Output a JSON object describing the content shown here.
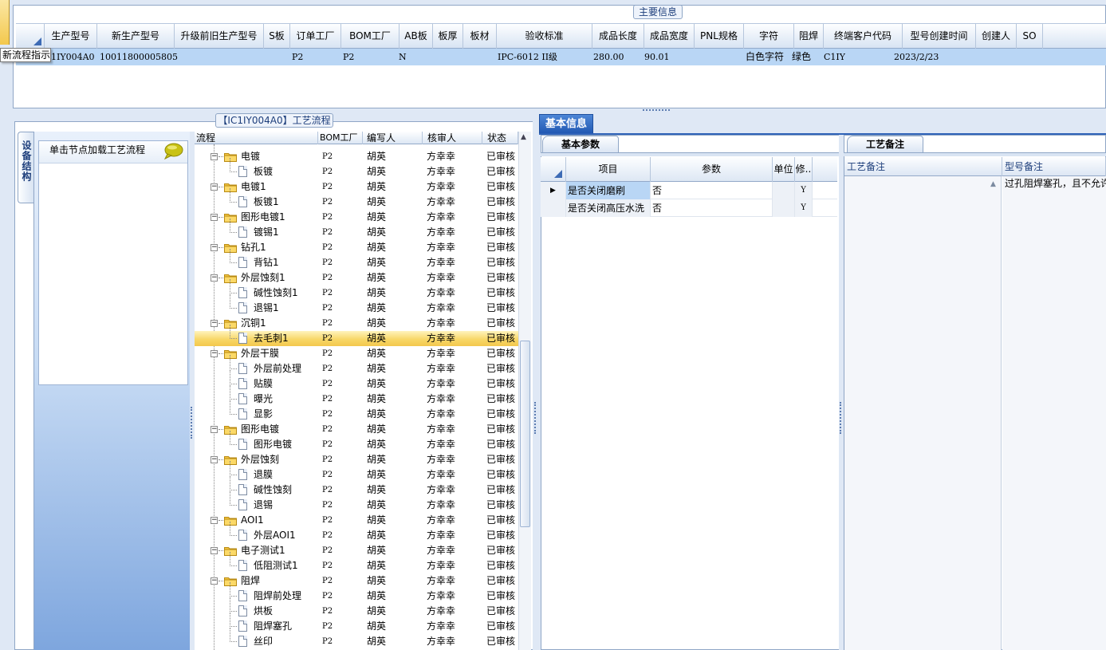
{
  "main_info": {
    "legend": "主要信息",
    "tooltip": "新流程指示",
    "columns": [
      "生产型号",
      "新生产型号",
      "升级前旧生产型号",
      "S板",
      "订单工厂",
      "BOM工厂",
      "AB板",
      "板厚",
      "板材",
      "验收标准",
      "成品长度",
      "成品宽度",
      "PNL规格",
      "字符",
      "阻焊",
      "终端客户代码",
      "型号创建时间",
      "创建人",
      "SO"
    ],
    "row": {
      "prod_model": "1IY004A0",
      "new_prod_model": "10011800005805",
      "order_factory": "P2",
      "bom_factory": "P2",
      "ab_board": "N",
      "acceptance": "IPC-6012 II级",
      "length": "280.00",
      "width": "90.01",
      "char": "白色字符",
      "solder": "绿色",
      "customer_code": "C1IY",
      "create_time": "2023/2/23"
    }
  },
  "flow_panel": {
    "legend": "【IC1IY004A0】工艺流程",
    "vtab": "设备结构",
    "hint": "单击节点加载工艺流程",
    "columns": {
      "flow": "流程",
      "bom": "BOM工厂",
      "writer": "编写人",
      "reviewer": "核审人",
      "status": "状态"
    },
    "rows": [
      {
        "label": "电镀",
        "level": 0,
        "bom": "P2",
        "writer": "胡英",
        "reviewer": "方幸幸",
        "status": "已审核"
      },
      {
        "label": "板镀",
        "level": 1,
        "bom": "P2",
        "writer": "胡英",
        "reviewer": "方幸幸",
        "status": "已审核"
      },
      {
        "label": "电镀1",
        "level": 0,
        "bom": "P2",
        "writer": "胡英",
        "reviewer": "方幸幸",
        "status": "已审核"
      },
      {
        "label": "板镀1",
        "level": 1,
        "bom": "P2",
        "writer": "胡英",
        "reviewer": "方幸幸",
        "status": "已审核"
      },
      {
        "label": "图形电镀1",
        "level": 0,
        "bom": "P2",
        "writer": "胡英",
        "reviewer": "方幸幸",
        "status": "已审核"
      },
      {
        "label": "镀锡1",
        "level": 1,
        "bom": "P2",
        "writer": "胡英",
        "reviewer": "方幸幸",
        "status": "已审核"
      },
      {
        "label": "钻孔1",
        "level": 0,
        "bom": "P2",
        "writer": "胡英",
        "reviewer": "方幸幸",
        "status": "已审核"
      },
      {
        "label": "背钻1",
        "level": 1,
        "bom": "P2",
        "writer": "胡英",
        "reviewer": "方幸幸",
        "status": "已审核"
      },
      {
        "label": "外层蚀刻1",
        "level": 0,
        "bom": "P2",
        "writer": "胡英",
        "reviewer": "方幸幸",
        "status": "已审核"
      },
      {
        "label": "碱性蚀刻1",
        "level": 1,
        "bom": "P2",
        "writer": "胡英",
        "reviewer": "方幸幸",
        "status": "已审核"
      },
      {
        "label": "退锡1",
        "level": 1,
        "bom": "P2",
        "writer": "胡英",
        "reviewer": "方幸幸",
        "status": "已审核"
      },
      {
        "label": "沉铜1",
        "level": 0,
        "bom": "P2",
        "writer": "胡英",
        "reviewer": "方幸幸",
        "status": "已审核"
      },
      {
        "label": "去毛刺1",
        "level": 1,
        "bom": "P2",
        "writer": "胡英",
        "reviewer": "方幸幸",
        "status": "已审核",
        "selected": true
      },
      {
        "label": "外层干膜",
        "level": 0,
        "bom": "P2",
        "writer": "胡英",
        "reviewer": "方幸幸",
        "status": "已审核"
      },
      {
        "label": "外层前处理",
        "level": 1,
        "bom": "P2",
        "writer": "胡英",
        "reviewer": "方幸幸",
        "status": "已审核"
      },
      {
        "label": "贴膜",
        "level": 1,
        "bom": "P2",
        "writer": "胡英",
        "reviewer": "方幸幸",
        "status": "已审核"
      },
      {
        "label": "曝光",
        "level": 1,
        "bom": "P2",
        "writer": "胡英",
        "reviewer": "方幸幸",
        "status": "已审核"
      },
      {
        "label": "显影",
        "level": 1,
        "bom": "P2",
        "writer": "胡英",
        "reviewer": "方幸幸",
        "status": "已审核"
      },
      {
        "label": "图形电镀",
        "level": 0,
        "bom": "P2",
        "writer": "胡英",
        "reviewer": "方幸幸",
        "status": "已审核"
      },
      {
        "label": "图形电镀",
        "level": 1,
        "bom": "P2",
        "writer": "胡英",
        "reviewer": "方幸幸",
        "status": "已审核"
      },
      {
        "label": "外层蚀刻",
        "level": 0,
        "bom": "P2",
        "writer": "胡英",
        "reviewer": "方幸幸",
        "status": "已审核"
      },
      {
        "label": "退膜",
        "level": 1,
        "bom": "P2",
        "writer": "胡英",
        "reviewer": "方幸幸",
        "status": "已审核"
      },
      {
        "label": "碱性蚀刻",
        "level": 1,
        "bom": "P2",
        "writer": "胡英",
        "reviewer": "方幸幸",
        "status": "已审核"
      },
      {
        "label": "退锡",
        "level": 1,
        "bom": "P2",
        "writer": "胡英",
        "reviewer": "方幸幸",
        "status": "已审核"
      },
      {
        "label": "AOI1",
        "level": 0,
        "bom": "P2",
        "writer": "胡英",
        "reviewer": "方幸幸",
        "status": "已审核"
      },
      {
        "label": "外层AOI1",
        "level": 1,
        "bom": "P2",
        "writer": "胡英",
        "reviewer": "方幸幸",
        "status": "已审核"
      },
      {
        "label": "电子测试1",
        "level": 0,
        "bom": "P2",
        "writer": "胡英",
        "reviewer": "方幸幸",
        "status": "已审核"
      },
      {
        "label": "低阻测试1",
        "level": 1,
        "bom": "P2",
        "writer": "胡英",
        "reviewer": "方幸幸",
        "status": "已审核"
      },
      {
        "label": "阻焊",
        "level": 0,
        "bom": "P2",
        "writer": "胡英",
        "reviewer": "方幸幸",
        "status": "已审核"
      },
      {
        "label": "阻焊前处理",
        "level": 1,
        "bom": "P2",
        "writer": "胡英",
        "reviewer": "方幸幸",
        "status": "已审核"
      },
      {
        "label": "烘板",
        "level": 1,
        "bom": "P2",
        "writer": "胡英",
        "reviewer": "方幸幸",
        "status": "已审核"
      },
      {
        "label": "阻焊塞孔",
        "level": 1,
        "bom": "P2",
        "writer": "胡英",
        "reviewer": "方幸幸",
        "status": "已审核"
      },
      {
        "label": "丝印",
        "level": 1,
        "bom": "P2",
        "writer": "胡英",
        "reviewer": "方幸幸",
        "status": "已审核"
      }
    ]
  },
  "basic_info": {
    "tab": "基本信息",
    "params_tab": "基本参数",
    "columns": {
      "item": "项目",
      "param": "参数",
      "unit": "单位",
      "mod": "修.."
    },
    "rows": [
      {
        "item": "是否关闭磨刷",
        "param": "否",
        "mod": "Y"
      },
      {
        "item": "是否关闭高压水洗",
        "param": "否",
        "mod": "Y"
      }
    ]
  },
  "notes": {
    "tab": "工艺备注",
    "col_process": "工艺备注",
    "col_model": "型号备注",
    "model_note": "过孔阻焊塞孔，且不允许"
  },
  "colors": {
    "selected_row": "#b9d6f5",
    "selected_tree": "#f8d768",
    "accent": "#2259b3"
  }
}
